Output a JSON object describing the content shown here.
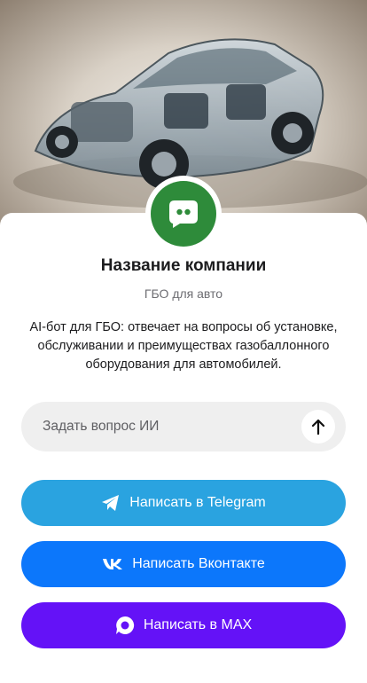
{
  "company": {
    "name": "Название компании",
    "category": "ГБО для авто",
    "description": "AI-бот для ГБО: отвечает на вопросы об установке, обслуживании и преимуществах газобаллонного оборудования для автомобилей.",
    "avatar_color": "#2e8b3a"
  },
  "ask": {
    "placeholder": "Задать вопрос ИИ",
    "send_icon": "arrow-up-icon"
  },
  "buttons": [
    {
      "label": "Написать в Telegram",
      "icon": "telegram-icon",
      "color": "#2aa3e0"
    },
    {
      "label": "Написать Вконтакте",
      "icon": "vk-icon",
      "color": "#0c77fb"
    },
    {
      "label": "Написать в MAX",
      "icon": "max-icon",
      "color": "#6412f7"
    }
  ]
}
